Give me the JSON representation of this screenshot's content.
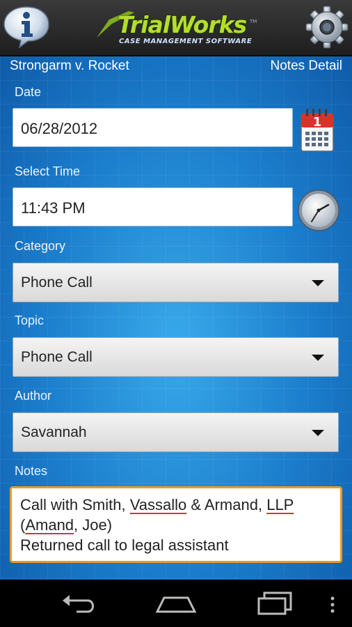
{
  "header": {
    "logo_name": "TrialWorks",
    "logo_tm": "TM",
    "logo_subtitle": "CASE MANAGEMENT SOFTWARE",
    "info_icon": "info-icon",
    "settings_icon": "gear-icon"
  },
  "subheader": {
    "case_title": "Strongarm v. Rocket",
    "screen_title": "Notes Detail"
  },
  "form": {
    "date_label": "Date",
    "date_value": "06/28/2012",
    "calendar_badge": "1",
    "time_label": "Select Time",
    "time_value": "11:43 PM",
    "category_label": "Category",
    "category_value": "Phone Call",
    "topic_label": "Topic",
    "topic_value": "Phone Call",
    "author_label": "Author",
    "author_value": "Savannah",
    "notes_label": "Notes",
    "notes": {
      "p1": "Call with Smith, ",
      "w1": "Vassallo",
      "p2": " & Armand, ",
      "w2": "LLP",
      "p3": "(",
      "w3": "Amand",
      "p4": ", Joe)",
      "line2": "Returned call to legal assistant"
    }
  },
  "colors": {
    "accent_orange": "#f39a1e",
    "logo_green": "#b6dd2c",
    "background_blue": "#1b7dcc"
  }
}
